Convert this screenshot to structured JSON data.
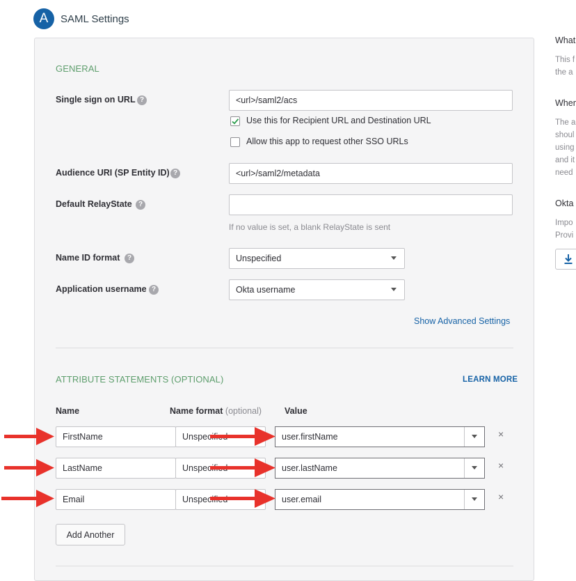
{
  "header": {
    "step_letter": "A",
    "title": "SAML Settings"
  },
  "general": {
    "section_title": "GENERAL",
    "sso_url": {
      "label": "Single sign on URL",
      "value": "<url>/saml2/acs"
    },
    "recipient_checkbox": {
      "label": "Use this for Recipient URL and Destination URL",
      "checked": true
    },
    "other_sso_checkbox": {
      "label": "Allow this app to request other SSO URLs",
      "checked": false
    },
    "audience_uri": {
      "label": "Audience URI (SP Entity ID)",
      "value": "<url>/saml2/metadata"
    },
    "relay_state": {
      "label": "Default RelayState",
      "value": "",
      "hint": "If no value is set, a blank RelayState is sent"
    },
    "name_id_format": {
      "label": "Name ID format",
      "value": "Unspecified"
    },
    "app_username": {
      "label": "Application username",
      "value": "Okta username"
    },
    "advanced_link": "Show Advanced Settings"
  },
  "attributes": {
    "section_title": "ATTRIBUTE STATEMENTS (OPTIONAL)",
    "learn_more": "LEARN MORE",
    "col_name": "Name",
    "col_name_format": "Name format",
    "col_name_format_optional": "(optional)",
    "col_value": "Value",
    "rows": [
      {
        "name": "FirstName",
        "format": "Unspecified",
        "value": "user.firstName"
      },
      {
        "name": "LastName",
        "format": "Unspecified",
        "value": "user.lastName"
      },
      {
        "name": "Email",
        "format": "Unspecified",
        "value": "user.email"
      }
    ],
    "remove_symbol": "×",
    "add_button": "Add Another"
  },
  "sidebar": {
    "section1": {
      "heading": "What",
      "lines": [
        "This f",
        "the a"
      ]
    },
    "section2": {
      "heading": "When",
      "lines": [
        "The a",
        "shoul",
        "using",
        "and it",
        "need"
      ]
    },
    "section3": {
      "heading": "Okta",
      "lines": [
        "Impo",
        "Provi"
      ]
    },
    "download_icon": "download-icon"
  },
  "colors": {
    "accent": "#1662a6",
    "section_green": "#5e9e6d",
    "annotation_arrow": "#e8322b"
  }
}
